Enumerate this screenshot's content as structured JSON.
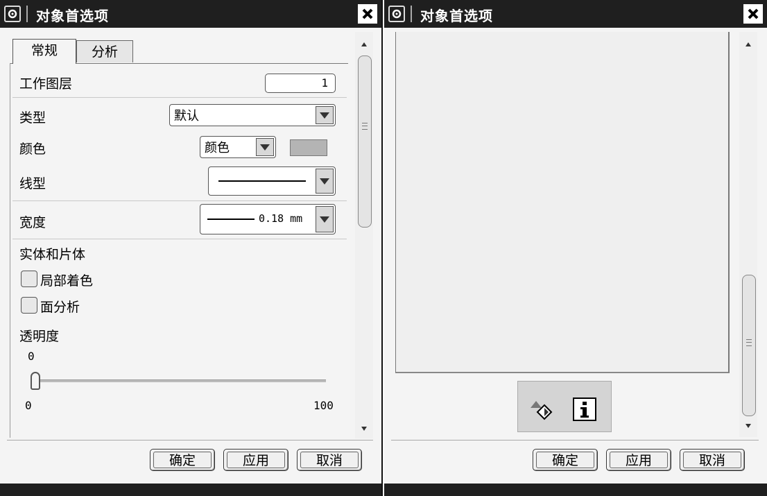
{
  "left_dialog": {
    "title": "对象首选项",
    "tabs": [
      {
        "label": "常规",
        "active": true
      },
      {
        "label": "分析",
        "active": false
      }
    ],
    "work_layer": {
      "label": "工作图层",
      "value": "1"
    },
    "type": {
      "label": "类型",
      "value": "默认"
    },
    "color": {
      "label": "颜色",
      "value": "颜色",
      "swatch": "#b4b4b4"
    },
    "line_type": {
      "label": "线型"
    },
    "width": {
      "label": "宽度",
      "value": "0.18 mm"
    },
    "solids_section": "实体和片体",
    "partial_shading": {
      "label": "局部着色",
      "checked": false
    },
    "face_analysis": {
      "label": "面分析",
      "checked": false
    },
    "transparency": {
      "label": "透明度",
      "value": "0",
      "min": "0",
      "max": "100",
      "level": 0
    },
    "buttons": {
      "ok": "确定",
      "apply": "应用",
      "cancel": "取消"
    }
  },
  "right_dialog": {
    "title": "对象首选项",
    "tool_icons": [
      "inherit-icon",
      "info-icon"
    ],
    "buttons": {
      "ok": "确定",
      "apply": "应用",
      "cancel": "取消"
    }
  },
  "colors": {
    "titlebar": "#1f1f1f",
    "dialog_bg": "#f4f4f4"
  }
}
